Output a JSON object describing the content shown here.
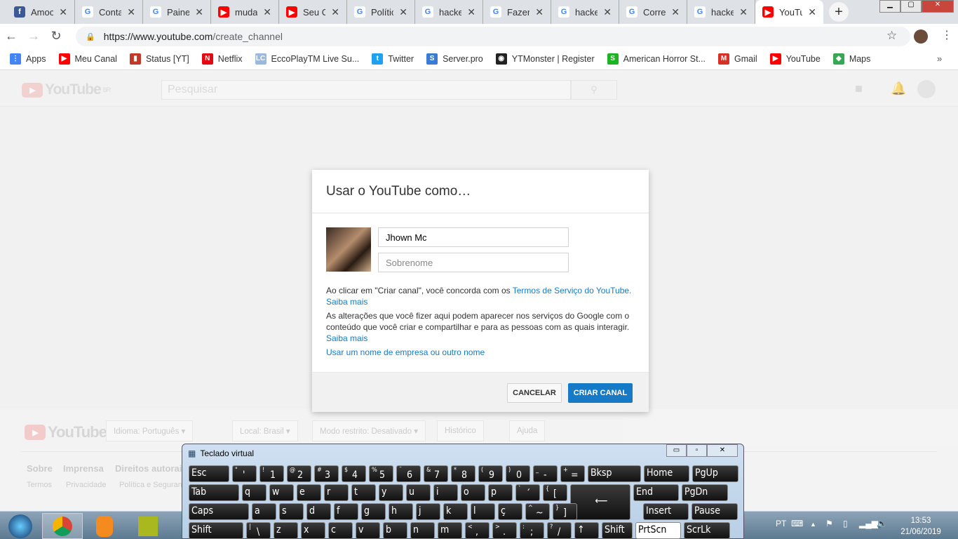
{
  "browser": {
    "tabs": [
      {
        "title": "Amoo",
        "icon": "facebook-icon",
        "color": "#3b5998"
      },
      {
        "title": "Conta",
        "icon": "google-icon",
        "color": "#4285f4"
      },
      {
        "title": "Painel",
        "icon": "google-icon",
        "color": "#4285f4"
      },
      {
        "title": "mudar",
        "icon": "youtube-icon",
        "color": "#ff0000"
      },
      {
        "title": "Seu Ca",
        "icon": "youtube-icon",
        "color": "#ff0000"
      },
      {
        "title": "Polític",
        "icon": "google-icon",
        "color": "#4285f4"
      },
      {
        "title": "hacke",
        "icon": "google-icon",
        "color": "#4285f4"
      },
      {
        "title": "Fazer",
        "icon": "google-icon",
        "color": "#4285f4"
      },
      {
        "title": "hacke",
        "icon": "google-icon",
        "color": "#4285f4"
      },
      {
        "title": "Correç",
        "icon": "google-icon",
        "color": "#4285f4"
      },
      {
        "title": "hacke",
        "icon": "google-icon",
        "color": "#4285f4"
      },
      {
        "title": "YouTu",
        "icon": "youtube-icon",
        "color": "#ff0000",
        "active": true
      }
    ],
    "url_domain": "https://www.youtube.com",
    "url_path": "/create_channel",
    "bookmarks": [
      {
        "label": "Apps",
        "color": "#4285f4",
        "glyph": "⋮"
      },
      {
        "label": "Meu Canal",
        "color": "#ff0000",
        "glyph": "▶"
      },
      {
        "label": "Status [YT]",
        "color": "#c0392b",
        "glyph": "▮"
      },
      {
        "label": "Netflix",
        "color": "#e50914",
        "glyph": "N"
      },
      {
        "label": "EccoPlayTM Live Su...",
        "color": "#9bb8e0",
        "glyph": "LC"
      },
      {
        "label": "Twitter",
        "color": "#1da1f2",
        "glyph": "t"
      },
      {
        "label": "Server.pro",
        "color": "#3a7bd5",
        "glyph": "S"
      },
      {
        "label": "YTMonster | Register",
        "color": "#222",
        "glyph": "◉"
      },
      {
        "label": "American Horror St...",
        "color": "#1db321",
        "glyph": "S"
      },
      {
        "label": "Gmail",
        "color": "#d93025",
        "glyph": "M"
      },
      {
        "label": "YouTube",
        "color": "#ff0000",
        "glyph": "▶"
      },
      {
        "label": "Maps",
        "color": "#34a853",
        "glyph": "◆"
      }
    ]
  },
  "youtube": {
    "logo": "YouTube",
    "region": "BR",
    "search_placeholder": "Pesquisar",
    "footer": {
      "buttons": [
        "Idioma: Português ▾",
        "Local: Brasil ▾",
        "Modo restrito: Desativado ▾",
        "Histórico",
        "Ajuda"
      ],
      "links1": [
        "Sobre",
        "Imprensa",
        "Direitos autorais"
      ],
      "links2": [
        "Termos",
        "Privacidade",
        "Política e Seguran"
      ]
    }
  },
  "dialog": {
    "title": "Usar o YouTube como…",
    "first_name": "Jhown Mc",
    "last_name_placeholder": "Sobrenome",
    "terms_prefix": "Ao clicar em \"Criar canal\", você concorda com os ",
    "terms_link": "Termos de Serviço do YouTube.",
    "learn_more": "Saiba mais",
    "changes_text": "As alterações que você fizer aqui podem aparecer nos serviços do Google com o conteúdo que você criar e compartilhar e para as pessoas com as quais interagir.",
    "business_link": "Usar um nome de empresa ou outro nome",
    "cancel": "CANCELAR",
    "create": "CRIAR CANAL"
  },
  "keyboard": {
    "title": "Teclado virtual",
    "rows": [
      [
        [
          "",
          "Esc"
        ],
        [
          "\"",
          "'"
        ],
        [
          "!",
          "1"
        ],
        [
          "@",
          "2"
        ],
        [
          "#",
          "3"
        ],
        [
          "$",
          "4"
        ],
        [
          "%",
          "5"
        ],
        [
          "¨",
          "6"
        ],
        [
          "&",
          "7"
        ],
        [
          "*",
          "8"
        ],
        [
          "(",
          "9"
        ],
        [
          ")",
          "0"
        ],
        [
          "_",
          "-"
        ],
        [
          "+",
          "="
        ],
        [
          "",
          "Bksp"
        ],
        [
          "",
          "Home"
        ],
        [
          "",
          "PgUp"
        ]
      ],
      [
        [
          "",
          "Tab"
        ],
        [
          "",
          "q"
        ],
        [
          "",
          "w"
        ],
        [
          "",
          "e"
        ],
        [
          "",
          "r"
        ],
        [
          "",
          "t"
        ],
        [
          "",
          "y"
        ],
        [
          "",
          "u"
        ],
        [
          "",
          "i"
        ],
        [
          "",
          "o"
        ],
        [
          "",
          "p"
        ],
        [
          "`",
          "´"
        ],
        [
          "{",
          "["
        ],
        [
          "",
          "⟵"
        ],
        [
          "",
          "End"
        ],
        [
          "",
          "PgDn"
        ]
      ],
      [
        [
          "",
          "Caps"
        ],
        [
          "",
          "a"
        ],
        [
          "",
          "s"
        ],
        [
          "",
          "d"
        ],
        [
          "",
          "f"
        ],
        [
          "",
          "g"
        ],
        [
          "",
          "h"
        ],
        [
          "",
          "j"
        ],
        [
          "",
          "k"
        ],
        [
          "",
          "l"
        ],
        [
          "",
          "ç"
        ],
        [
          "^",
          "~"
        ],
        [
          "}",
          "]"
        ],
        [
          "",
          ""
        ],
        [
          "",
          "Insert"
        ],
        [
          "",
          "Pause"
        ]
      ],
      [
        [
          "",
          "Shift"
        ],
        [
          "|",
          "\\"
        ],
        [
          "",
          "z"
        ],
        [
          "",
          "x"
        ],
        [
          "",
          "c"
        ],
        [
          "",
          "v"
        ],
        [
          "",
          "b"
        ],
        [
          "",
          "n"
        ],
        [
          "",
          "m"
        ],
        [
          "<",
          ","
        ],
        [
          ">",
          "."
        ],
        [
          ":",
          ";"
        ],
        [
          "?",
          "/"
        ],
        [
          "",
          "↑"
        ],
        [
          "",
          "Shift"
        ],
        [
          "",
          "PrtScn"
        ],
        [
          "",
          "ScrLk"
        ]
      ]
    ]
  },
  "taskbar": {
    "lang": "PT",
    "time": "13:53",
    "date": "21/06/2019"
  }
}
